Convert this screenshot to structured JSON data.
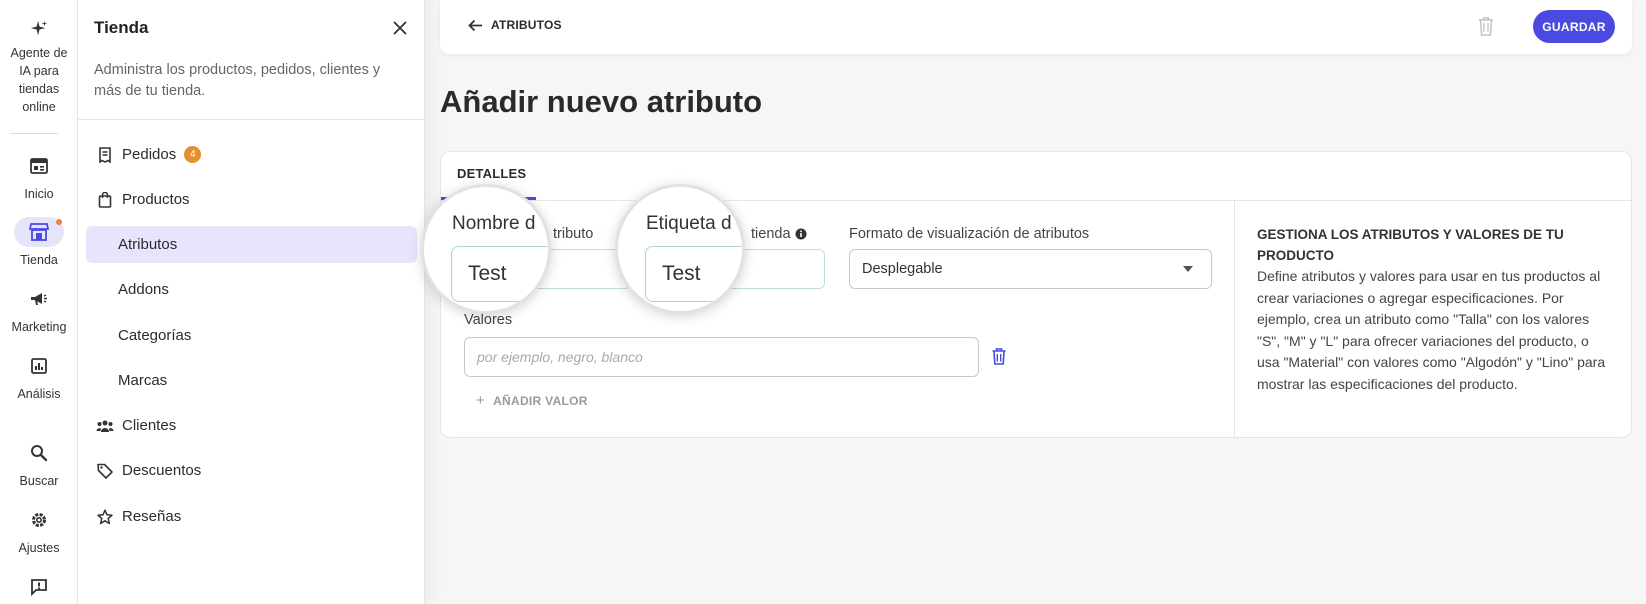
{
  "rail": {
    "items": [
      {
        "label": "Agente de IA para tiendas online",
        "icon": "sparkle-icon"
      },
      {
        "label": "Inicio",
        "icon": "home-icon"
      },
      {
        "label": "Tienda",
        "icon": "store-icon"
      },
      {
        "label": "Marketing",
        "icon": "megaphone-icon"
      },
      {
        "label": "Análisis",
        "icon": "chart-icon"
      },
      {
        "label": "Buscar",
        "icon": "search-icon"
      },
      {
        "label": "Ajustes",
        "icon": "gear-icon"
      },
      {
        "label": "",
        "icon": "feedback-icon"
      }
    ],
    "label_lines": {
      "ai": [
        "Agente de",
        "IA para",
        "tiendas",
        "online"
      ]
    }
  },
  "panel": {
    "title": "Tienda",
    "description": "Administra los productos, pedidos, clientes y más de tu tienda.",
    "nav": [
      {
        "label": "Pedidos",
        "badge": "4",
        "icon": "receipt-icon"
      },
      {
        "label": "Productos",
        "icon": "bag-icon"
      },
      {
        "label": "Atributos"
      },
      {
        "label": "Addons"
      },
      {
        "label": "Categorías"
      },
      {
        "label": "Marcas"
      },
      {
        "label": "Clientes",
        "icon": "users-icon"
      },
      {
        "label": "Descuentos",
        "icon": "tag-icon"
      },
      {
        "label": "Reseñas",
        "icon": "star-icon"
      }
    ]
  },
  "topbar": {
    "back_label": "ATRIBUTOS",
    "save_label": "GUARDAR"
  },
  "page": {
    "title": "Añadir nuevo atributo"
  },
  "form": {
    "tab": "DETALLES",
    "name_label_visible": "tributo",
    "name_value": "Test",
    "store_label_visible": "tienda",
    "store_value": "Test",
    "display_label": "Formato de visualización de atributos",
    "display_value": "Desplegable",
    "values_label": "Valores",
    "values_placeholder": "por ejemplo, negro, blanco",
    "add_value": "AÑADIR VALOR"
  },
  "magnifier": {
    "name_label": "Nombre d",
    "name_value": "Test",
    "store_label": "Etiqueta d",
    "store_value": "Test"
  },
  "help": {
    "title": "GESTIONA LOS ATRIBUTOS Y VALORES DE TU PRODUCTO",
    "body": "Define atributos y valores para usar en tus productos al crear variaciones o agregar especificaciones. Por ejemplo, crea un atributo como \"Talla\" con los valores \"S\", \"M\" y \"L\" para ofrecer variaciones del producto, o usa \"Material\" con valores como \"Algodón\" y \"Lino\" para mostrar las especificaciones del producto."
  },
  "colors": {
    "accent": "#4a4ae0",
    "badge": "#e49030",
    "active_bg": "#e6e5fb"
  }
}
